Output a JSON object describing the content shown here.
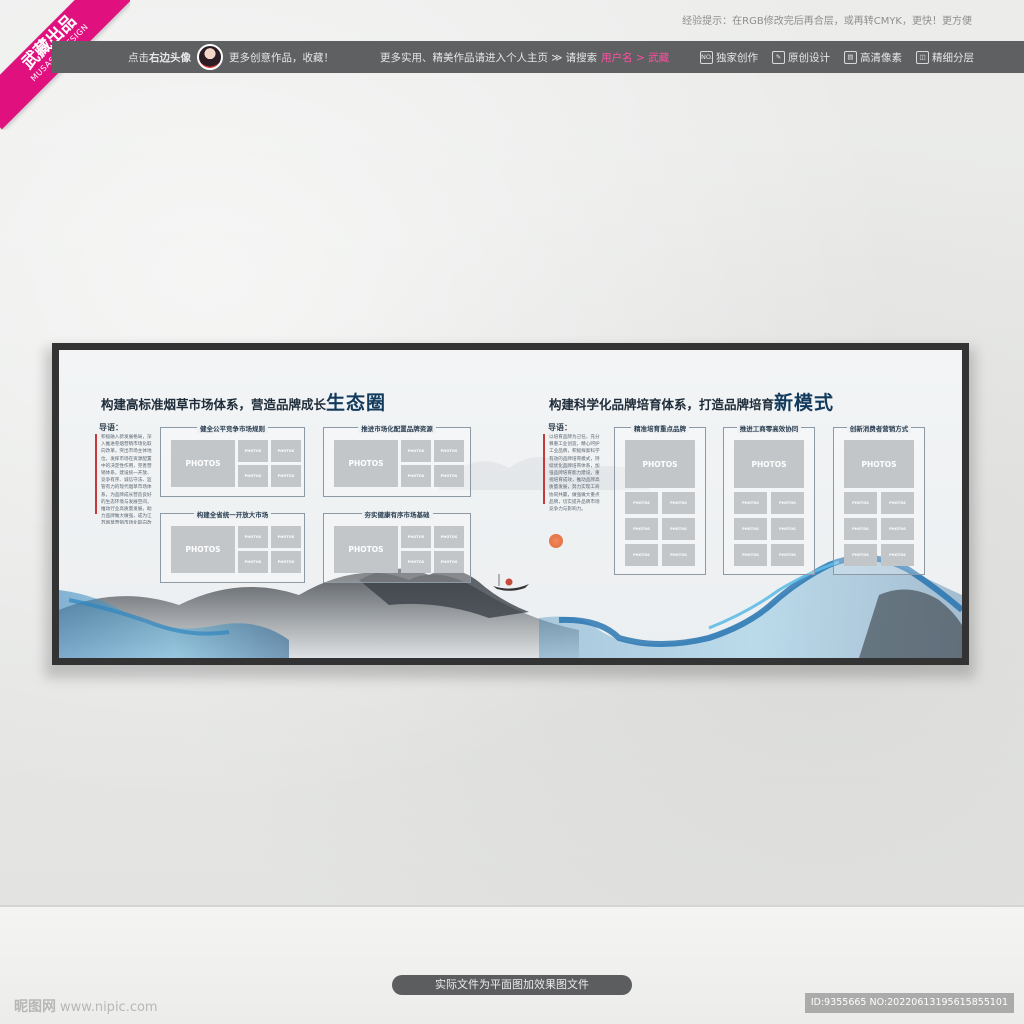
{
  "top_hint": "经验提示：在RGB修改完后再合层，或再转CMYK，更快！更方便",
  "ribbon": {
    "main": "武藏出品",
    "sub": "MUSASHI DESIGN"
  },
  "info_bar": {
    "avatar_prompt_prefix": "点击",
    "avatar_prompt_bold": "右边头像",
    "more_works": "更多创意作品，收藏！",
    "homepage_text": "更多实用、精美作品请进入个人主页 ≫ 请搜索 ",
    "search_target": "用户名 > 武藏",
    "badges": [
      {
        "icon": "NO.",
        "label": "独家创作"
      },
      {
        "icon": "✎",
        "label": "原创设计"
      },
      {
        "icon": "▤",
        "label": "高清像素"
      },
      {
        "icon": "◫",
        "label": "精细分层"
      }
    ]
  },
  "board": {
    "left": {
      "title_main": "构建高标准烟草市场体系，营造品牌成长",
      "title_accent": "生态圈",
      "intro_heading": "导语：",
      "intro_text": "积极融入新发展格局，深入推进卷烟营销市场化取向改革，突出市场主体地位，发挥市场在资源配置中的决定性作用，完善营销体系，建设统一开放、竞争有序、诚信守法、监管有力的现代烟草市场体系，为品牌成长营造良好的生态环境与发展空间，推动行业高质量发展，助力品牌做大做强，成为江苏烟草营销市场化取向改革的重要标志。",
      "panels": [
        {
          "title": "健全公平竞争市场规则"
        },
        {
          "title": "推进市场化配置品牌资源"
        },
        {
          "title": "构建全省统一开放大市场"
        },
        {
          "title": "夯实健康有序市场基础"
        }
      ]
    },
    "right": {
      "title_main": "构建科学化品牌培育体系，打造品牌培育",
      "title_accent": "新模式",
      "intro_heading": "导语：",
      "intro_text": "以培育品牌为己任，充分尊重工业创造，精心呵护工业品牌，积极探索科学有效的品牌培育模式，持续优化品牌培育体系，加强品牌培育能力建设，重视培育成效，推动品牌高质量发展，努力实现工商协同共赢，做强做大重点品牌，切实提升品牌市场竞争力与影响力。",
      "panels": [
        {
          "title": "精准培育重点品牌"
        },
        {
          "title": "推进工商零高效协同"
        },
        {
          "title": "创新消费者营销方式"
        }
      ]
    },
    "photo_label": "PHOTOS"
  },
  "caption": "实际文件为平面图加效果图文件",
  "watermark_left": {
    "logo": "昵图网",
    "url": "www.nipic.com"
  },
  "watermark_right": "ID:9355665 NO:20220613195615855101"
}
